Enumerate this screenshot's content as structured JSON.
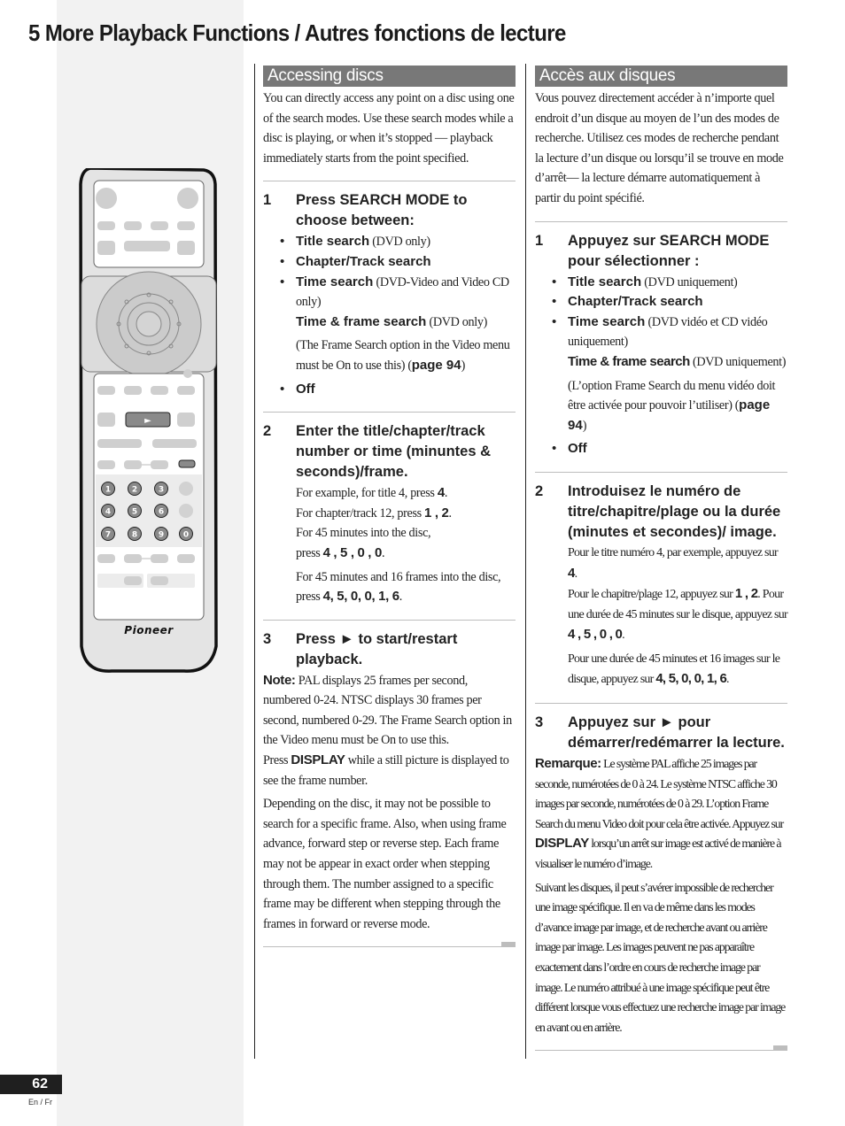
{
  "page": {
    "title": "5 More Playback Functions / Autres fonctions de lecture",
    "page_number": "62",
    "language_label": "En / Fr"
  },
  "remote": {
    "play_symbol": "►",
    "number_keys": [
      "1",
      "2",
      "3",
      "4",
      "5",
      "6",
      "7",
      "8",
      "9",
      "0"
    ],
    "brand": "Pioneer"
  },
  "english": {
    "heading": "Accessing discs",
    "intro": "You can directly access any point on a disc using one of the search modes. Use these search modes while a disc is playing, or when it’s stopped — playback immediately starts from the point specified.",
    "step1": {
      "num": "1",
      "title": "Press SEARCH MODE to choose between:",
      "items": [
        {
          "label": "Title search",
          "detail": " (DVD only)"
        },
        {
          "label": "Chapter/Track search",
          "detail": ""
        },
        {
          "label": "Time search",
          "detail": " (DVD-Video and Video CD only)"
        }
      ],
      "sub_item": {
        "label": "Time & frame search",
        "detail": " (DVD only)"
      },
      "sub_note_pre": "(The Frame Search option in the Video menu must be On to use this) (",
      "sub_note_link": "page 94",
      "sub_note_post": ")",
      "last_item": "Off"
    },
    "step2": {
      "num": "2",
      "title": "Enter the title/chapter/track number or time (minuntes & seconds)/frame.",
      "line1_pre": "For example, for title 4, press ",
      "line1_keys": "4",
      "line2_pre": "For chapter/track 12, press ",
      "line2_keys": "1 , 2",
      "line3": "For 45 minutes into the disc,",
      "line4_pre": "press ",
      "line4_keys": "4 , 5 , 0 , 0",
      "line5_pre": "For 45 minutes and 16 frames into the disc, press ",
      "line5_keys": "4, 5, 0, 0, 1, 6"
    },
    "step3": {
      "num": "3",
      "title": "Press ► to start/restart playback.",
      "note_label": "Note:",
      "note_text": " PAL displays 25 frames per second, numbered 0-24. NTSC displays 30 frames per second, numbered 0-29. The Frame Search option in the Video menu must be On to use this.",
      "display_pre": "Press ",
      "display_key": "DISPLAY",
      "display_post": " while a still picture is displayed to see the frame number.",
      "para": "Depending on the disc, it may not be possible to search for a specific frame. Also, when using frame advance, forward step or reverse step. Each frame may not be appear in exact order when stepping through them. The number assigned to a specific frame may be different when stepping through the frames in forward or reverse mode."
    }
  },
  "french": {
    "heading": "Accès aux disques",
    "intro": "Vous pouvez directement accéder à n’importe quel endroit d’un disque au moyen de l’un des modes de recherche. Utilisez ces modes de recherche pendant la lecture d’un disque ou lorsqu’il se trouve en mode d’arrêt— la lecture démarre automatiquement à partir du point spécifié.",
    "step1": {
      "num": "1",
      "title": "Appuyez sur SEARCH MODE pour sélectionner :",
      "items": [
        {
          "label": "Title search",
          "detail": " (DVD uniquement)"
        },
        {
          "label": "Chapter/Track search",
          "detail": ""
        },
        {
          "label": "Time search",
          "detail": " (DVD vidéo et CD vidéo uniquement)"
        }
      ],
      "sub_item": {
        "label": "Time & frame search",
        "detail": " (DVD uniquement)"
      },
      "sub_note_pre": "(L’option Frame Search du menu vidéo doit être activée pour pouvoir l’utiliser) (",
      "sub_note_link": "page 94",
      "sub_note_post": ")",
      "last_item": "Off"
    },
    "step2": {
      "num": "2",
      "title": "Introduisez le numéro de titre/chapitre/plage ou la durée (minutes et secondes)/ image.",
      "line1_pre": "Pour le titre numéro 4, par exemple, appuyez sur ",
      "line1_keys": "4",
      "line2_pre": "Pour le chapitre/plage 12, appuyez sur ",
      "line2_keys": "1 , 2",
      "line3": "Pour une durée de 45 minutes sur le disque,",
      "line4_pre": "appuyez sur ",
      "line4_keys": "4 , 5 , 0 , 0",
      "line5_pre": "Pour une durée de 45 minutes et 16 images sur le disque, appuyez sur ",
      "line5_keys": "4, 5, 0, 0, 1, 6"
    },
    "step3": {
      "num": "3",
      "title": "Appuyez sur ► pour démarrer/redémarrer la lecture.",
      "note_label": "Remarque:",
      "note_text": " Le système PAL affiche 25 images par seconde, numérotées de 0 à 24. Le système NTSC affiche 30 images par seconde, numérotées de 0 à 29.  L’option Frame Search du menu Video doit pour cela être activée.",
      "display_pre": "Appuyez sur ",
      "display_key": "DISPLAY",
      "display_post": " lorsqu’un arrêt sur image est activé de manière à visualiser le numéro d’image.",
      "para": "Suivant les disques, il peut s’avérer impossible de rechercher une image spécifique. Il en va de même dans les modes d’avance image par image, et de recherche avant ou arrière image par image. Les images peuvent ne pas apparaître exactement dans l’ordre en cours de recherche image par image. Le numéro attribué à une image spécifique peut être différent lorsque vous effectuez une recherche image par image en avant ou en arrière."
    }
  }
}
